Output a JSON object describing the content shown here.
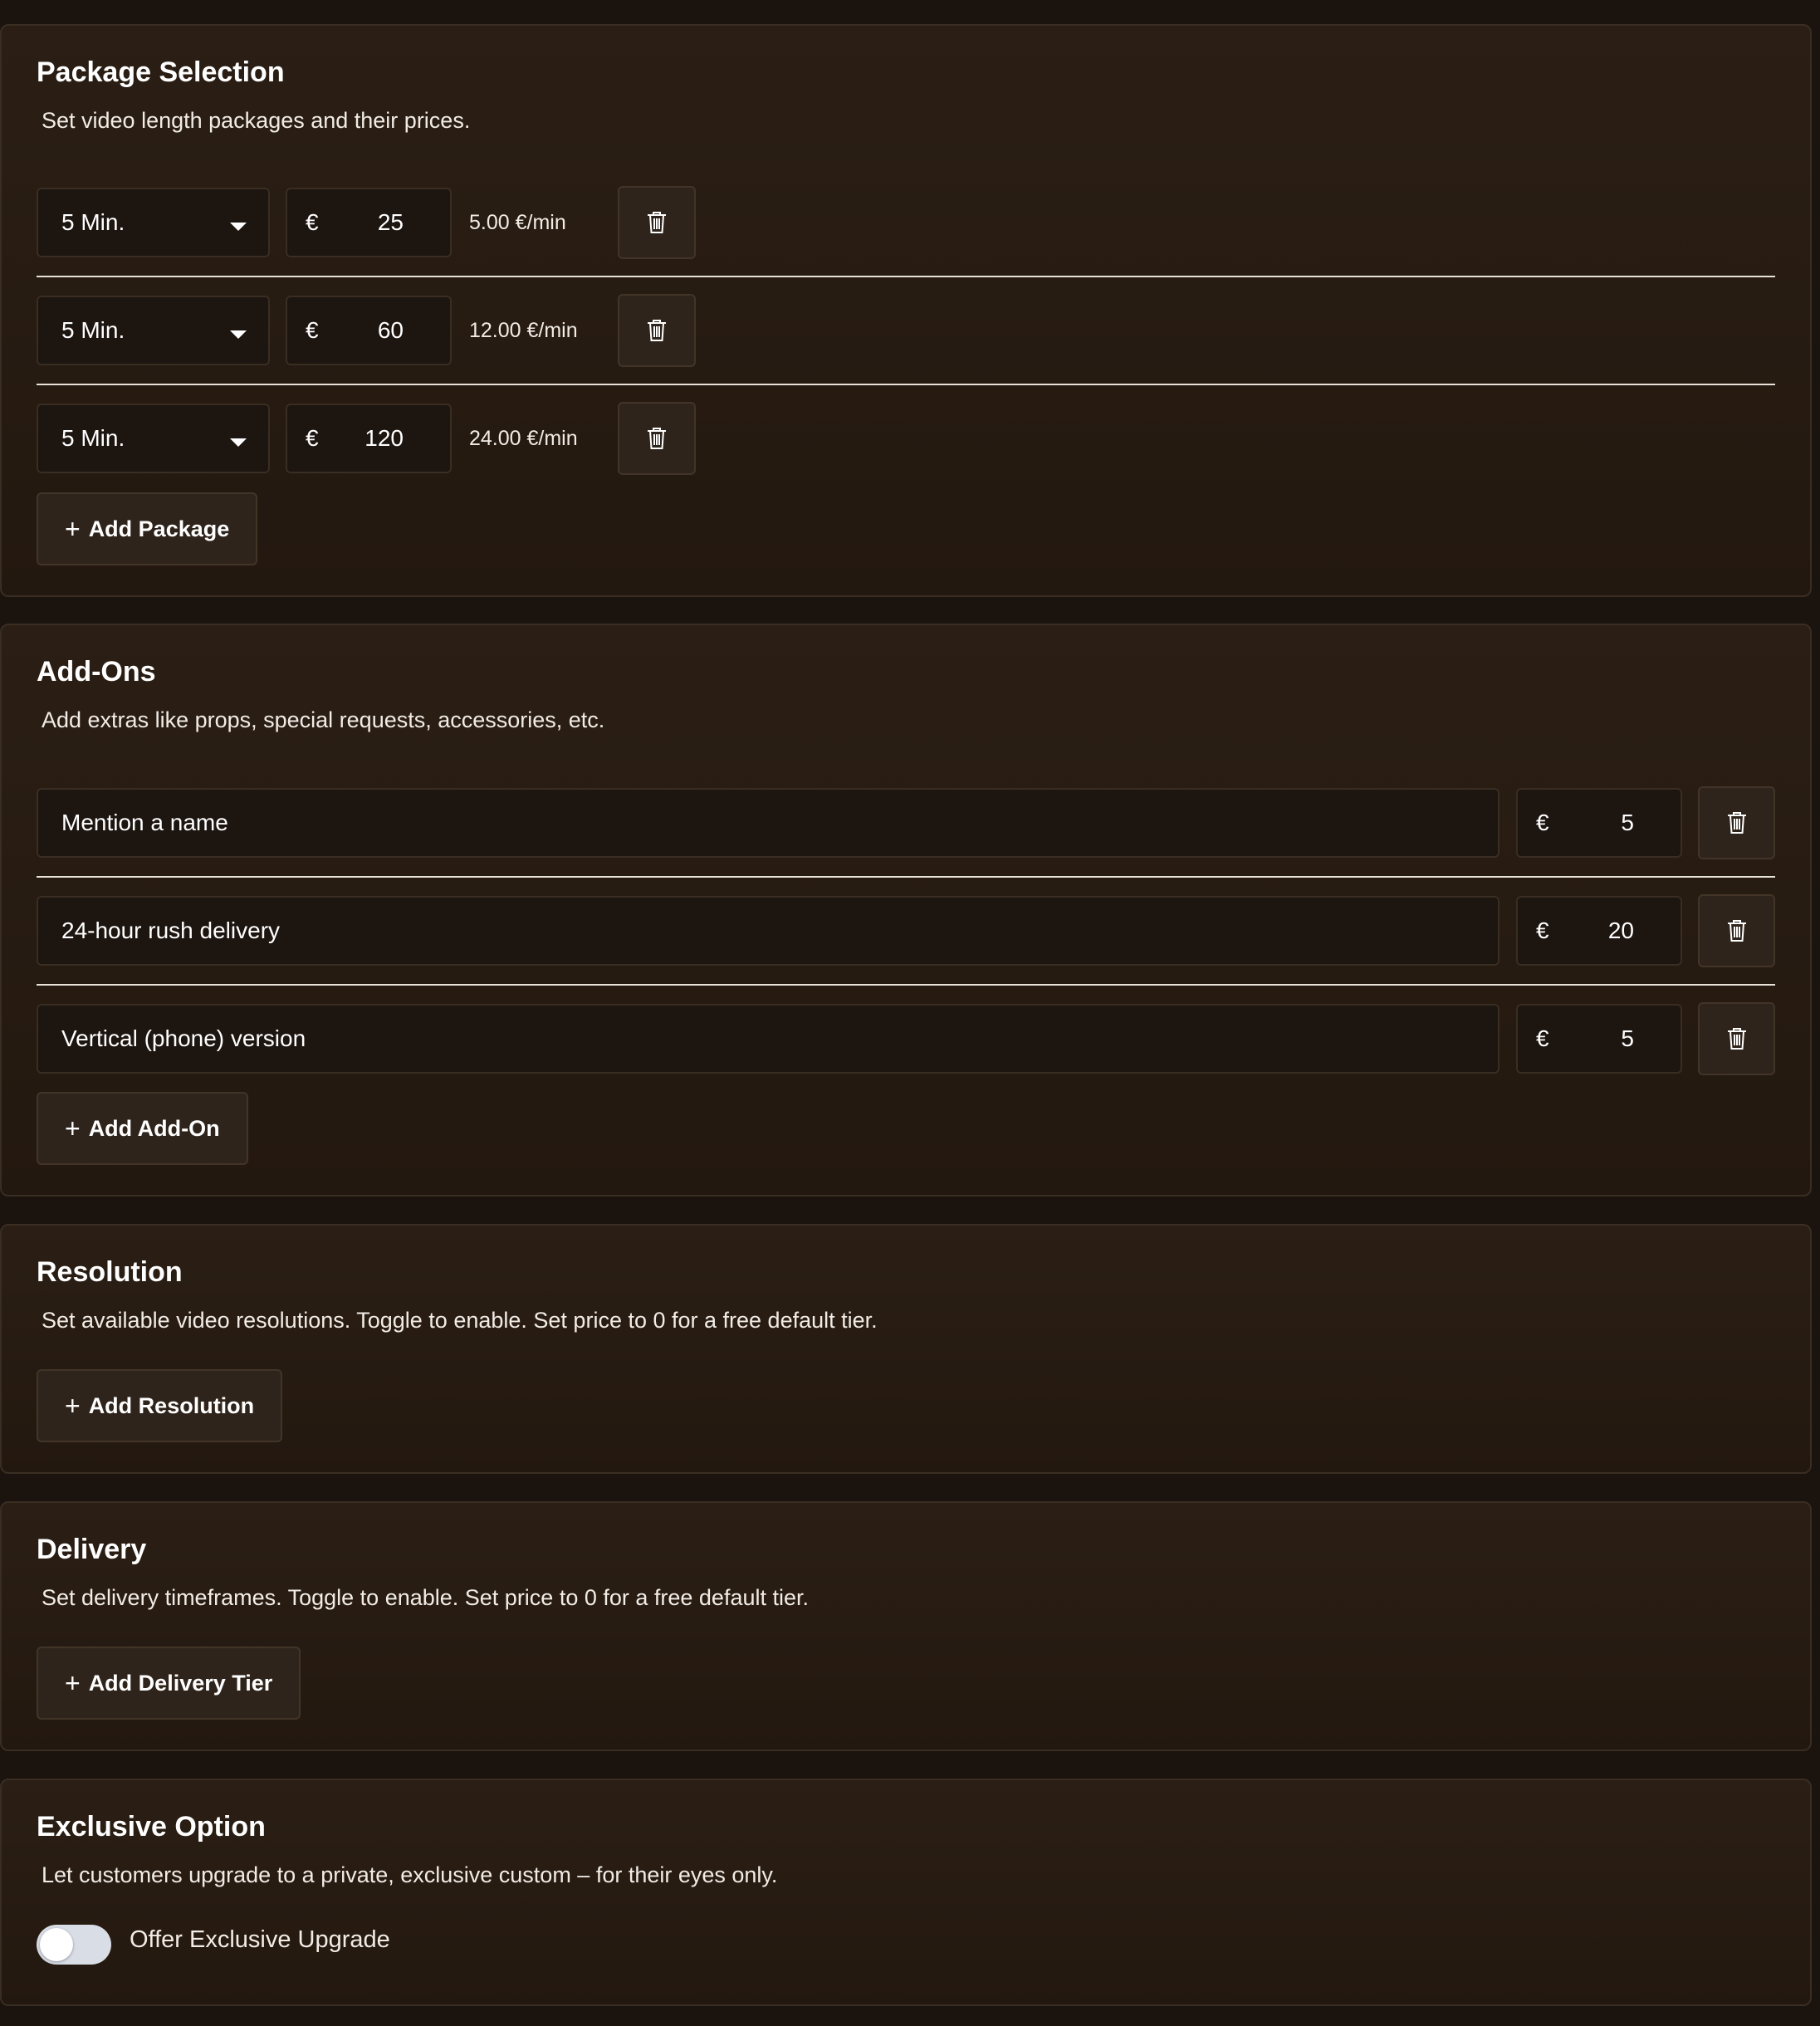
{
  "package_selection": {
    "title": "Package Selection",
    "description": "Set video length packages and their prices.",
    "rows": [
      {
        "length": "5 Min.",
        "currency": "€",
        "price": "25",
        "rate": "5.00 €/min"
      },
      {
        "length": "5 Min.",
        "currency": "€",
        "price": "60",
        "rate": "12.00 €/min"
      },
      {
        "length": "5 Min.",
        "currency": "€",
        "price": "120",
        "rate": "24.00 €/min"
      }
    ],
    "add_label": "Add Package"
  },
  "addons": {
    "title": "Add-Ons",
    "description": "Add extras like props, special requests, accessories, etc.",
    "rows": [
      {
        "name": "Mention a name",
        "currency": "€",
        "price": "5"
      },
      {
        "name": "24-hour rush delivery",
        "currency": "€",
        "price": "20"
      },
      {
        "name": "Vertical (phone) version",
        "currency": "€",
        "price": "5"
      }
    ],
    "add_label": "Add Add-On"
  },
  "resolution": {
    "title": "Resolution",
    "description": "Set available video resolutions. Toggle to enable. Set price to 0 for a free default tier.",
    "add_label": "Add Resolution"
  },
  "delivery": {
    "title": "Delivery",
    "description": "Set delivery timeframes. Toggle to enable. Set price to 0 for a free default tier.",
    "add_label": "Add Delivery Tier"
  },
  "exclusive": {
    "title": "Exclusive Option",
    "description": "Let customers upgrade to a private, exclusive custom – for their eyes only.",
    "toggle_label": "Offer Exclusive Upgrade",
    "toggle_on": false
  },
  "icons": {
    "delete": "trash-icon",
    "add": "plus-icon",
    "dropdown": "chevron-down-icon"
  },
  "colors": {
    "background": "#1a130e",
    "card": "#2b1f15",
    "border": "#3a2d22",
    "divider": "#e9e2da",
    "toggle_off": "#d9dde6"
  }
}
